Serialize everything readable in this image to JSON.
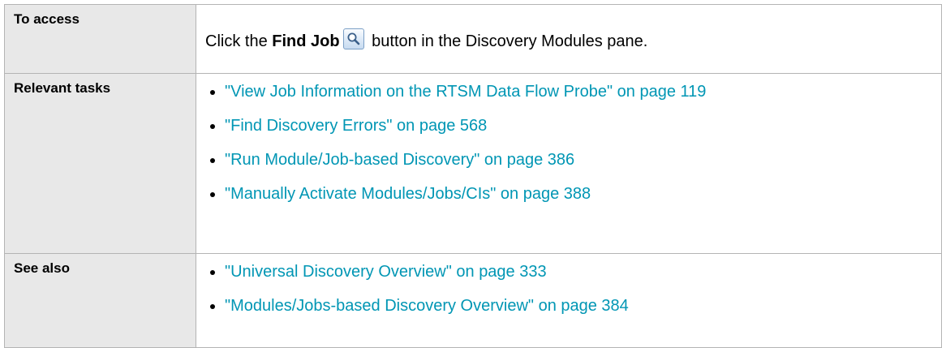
{
  "access": {
    "label": "To access",
    "text_before": "Click the ",
    "button_name": "Find Job",
    "icon": "magnifier-icon",
    "text_after": " button in the Discovery Modules pane."
  },
  "relevant_tasks": {
    "label": "Relevant tasks",
    "links": [
      {
        "title": "\"View Job Information on the RTSM Data Flow Probe\"",
        "page": " on page 119"
      },
      {
        "title": "\"Find Discovery Errors\"",
        "page": " on page 568"
      },
      {
        "title": "\"Run Module/Job-based Discovery\"",
        "page": " on page 386"
      },
      {
        "title": "\"Manually Activate Modules/Jobs/CIs\"",
        "page": " on page 388"
      }
    ]
  },
  "see_also": {
    "label": "See also",
    "links": [
      {
        "title": "\"Universal Discovery Overview\"",
        "page": " on page 333"
      },
      {
        "title": "\"Modules/Jobs-based Discovery Overview\"",
        "page": " on page 384"
      }
    ]
  },
  "colors": {
    "link": "#0096b4",
    "label_background": "#e8e8e8",
    "border": "#b4b4b4"
  }
}
